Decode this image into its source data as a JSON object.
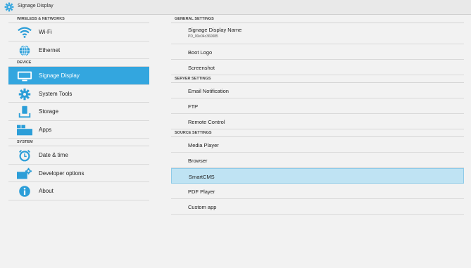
{
  "window": {
    "title": "Signage Display"
  },
  "left": {
    "sections": [
      {
        "header": "WIRELESS & NETWORKS",
        "items": [
          {
            "label": "Wi-Fi",
            "icon": "wifi-icon"
          },
          {
            "label": "Ethernet",
            "icon": "ethernet-globe-icon"
          }
        ]
      },
      {
        "header": "DEVICE",
        "items": [
          {
            "label": "Signage Display",
            "icon": "display-icon",
            "selected": true
          },
          {
            "label": "System Tools",
            "icon": "gear-icon"
          },
          {
            "label": "Storage",
            "icon": "storage-icon"
          },
          {
            "label": "Apps",
            "icon": "apps-icon"
          }
        ]
      },
      {
        "header": "SYSTEM",
        "items": [
          {
            "label": "Date & time",
            "icon": "clock-icon"
          },
          {
            "label": "Developer options",
            "icon": "developer-options-icon"
          },
          {
            "label": "About",
            "icon": "info-icon"
          }
        ]
      }
    ]
  },
  "right": {
    "general_header": "GENERAL SETTINGS",
    "signage_name": {
      "label": "Signage Display Name",
      "value": "PD_00e04c360085"
    },
    "boot_logo": "Boot Logo",
    "screenshot": "Screenshot",
    "server_header": "SERVER SETTINGS",
    "email_notification": "Email Notification",
    "ftp": "FTP",
    "remote_control": "Remote Control",
    "source_header": "SOURCE SETTINGS",
    "media_player": "Media Player",
    "browser": "Browser",
    "smartcms": "SmartCMS",
    "pdf_player": "PDF Player",
    "custom_app": "Custom app"
  },
  "colors": {
    "selected_bg": "#33a6df",
    "highlight_bg": "#bfe3f3",
    "icon_blue": "#2c9ed8"
  }
}
